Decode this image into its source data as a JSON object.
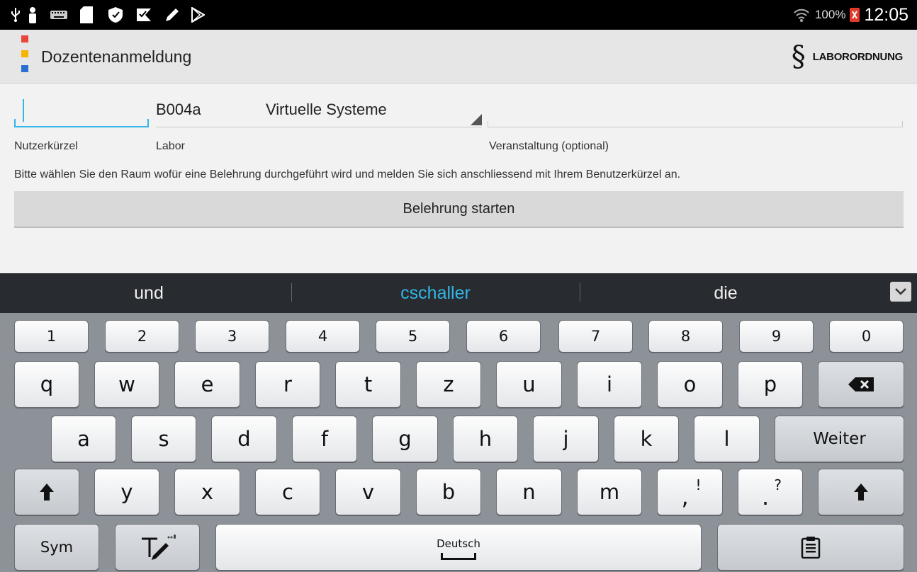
{
  "statusbar": {
    "battery_percent": "100%",
    "clock": "12:05",
    "icons": [
      "usb-icon",
      "person-icon",
      "keyboard-icon",
      "sd-card-icon",
      "shield-icon",
      "checkmark-flag-icon",
      "pencil-icon",
      "play-store-icon",
      "wifi-icon",
      "battery-icon"
    ]
  },
  "actionbar": {
    "title": "Dozentenanmeldung",
    "logo_colors": [
      "#e8453c",
      "#f7b500",
      "#2a6fd1"
    ],
    "paragraph_symbol": "§",
    "laborordnung_label": "LABORORDNUNG"
  },
  "form": {
    "nutzer_value": "",
    "nutzer_label": "Nutzerkürzel",
    "labor_code": "B004a",
    "labor_name": "Virtuelle Systeme",
    "labor_label": "Labor",
    "veranstaltung_value": "",
    "veranstaltung_label": "Veranstaltung (optional)",
    "hint": "Bitte wählen Sie den Raum wofür eine Belehrung durchgeführt wird und melden Sie sich anschliessend mit Ihrem Benutzerkürzel an.",
    "start_button": "Belehrung starten"
  },
  "keyboard": {
    "suggestions": [
      "und",
      "cschaller",
      "die"
    ],
    "active_suggestion_color": "#33b5e5",
    "number_row": [
      "1",
      "2",
      "3",
      "4",
      "5",
      "6",
      "7",
      "8",
      "9",
      "0"
    ],
    "row1": [
      "q",
      "w",
      "e",
      "r",
      "t",
      "z",
      "u",
      "i",
      "o",
      "p"
    ],
    "row2": [
      "a",
      "s",
      "d",
      "f",
      "g",
      "h",
      "j",
      "k",
      "l"
    ],
    "row3": [
      "y",
      "x",
      "c",
      "v",
      "b",
      "n",
      "m"
    ],
    "comma_key": {
      "main": ",",
      "alt": "!"
    },
    "period_key": {
      "main": ".",
      "alt": "?"
    },
    "enter_label": "Weiter",
    "sym_label": "Sym",
    "space_label": "Deutsch"
  }
}
